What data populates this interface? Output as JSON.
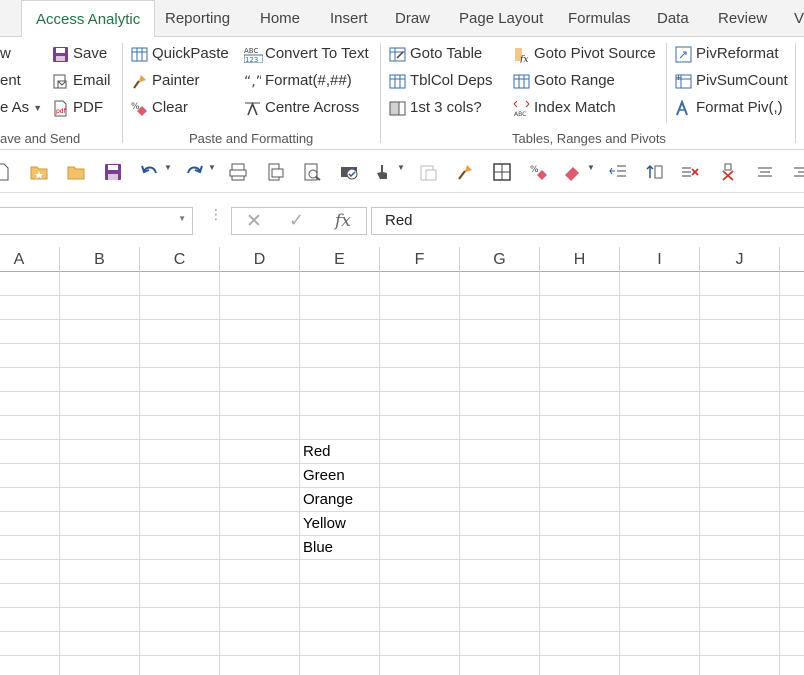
{
  "ribbon_tabs": [
    {
      "label": "Access Analytic",
      "active": true
    },
    {
      "label": "Reporting"
    },
    {
      "label": "Home"
    },
    {
      "label": "Insert"
    },
    {
      "label": "Draw"
    },
    {
      "label": "Page Layout"
    },
    {
      "label": "Formulas"
    },
    {
      "label": "Data"
    },
    {
      "label": "Review"
    },
    {
      "label": "V"
    }
  ],
  "groups": {
    "save_send": {
      "label": "ave and Send",
      "cut_left": [
        "w",
        "ent",
        "e As"
      ],
      "buttons": [
        "Save",
        "Email",
        "PDF"
      ]
    },
    "paste_formatting": {
      "label": "Paste and Formatting",
      "col1": [
        "QuickPaste",
        "Painter",
        "Clear"
      ],
      "col2": [
        "Convert To Text",
        "Format(#,##)",
        "Centre Across"
      ]
    },
    "tables": {
      "label": "Tables, Ranges and Pivots",
      "col1": [
        "Goto Table",
        "TblCol Deps",
        "1st 3 cols?"
      ],
      "col2": [
        "Goto Pivot Source",
        "Goto Range",
        "Index Match"
      ],
      "col3": [
        "PivReformat",
        "PivSumCount",
        "Format Piv(,)"
      ]
    }
  },
  "formula_bar": {
    "value": "Red",
    "fx": "fx"
  },
  "columns": [
    "A",
    "B",
    "C",
    "D",
    "E",
    "F",
    "G",
    "H",
    "I",
    "J"
  ],
  "cells_E": [
    "Red",
    "Green",
    "Orange",
    "Yellow",
    "Blue"
  ],
  "colors": {
    "accent": "#217346",
    "grid": "#dadada"
  }
}
